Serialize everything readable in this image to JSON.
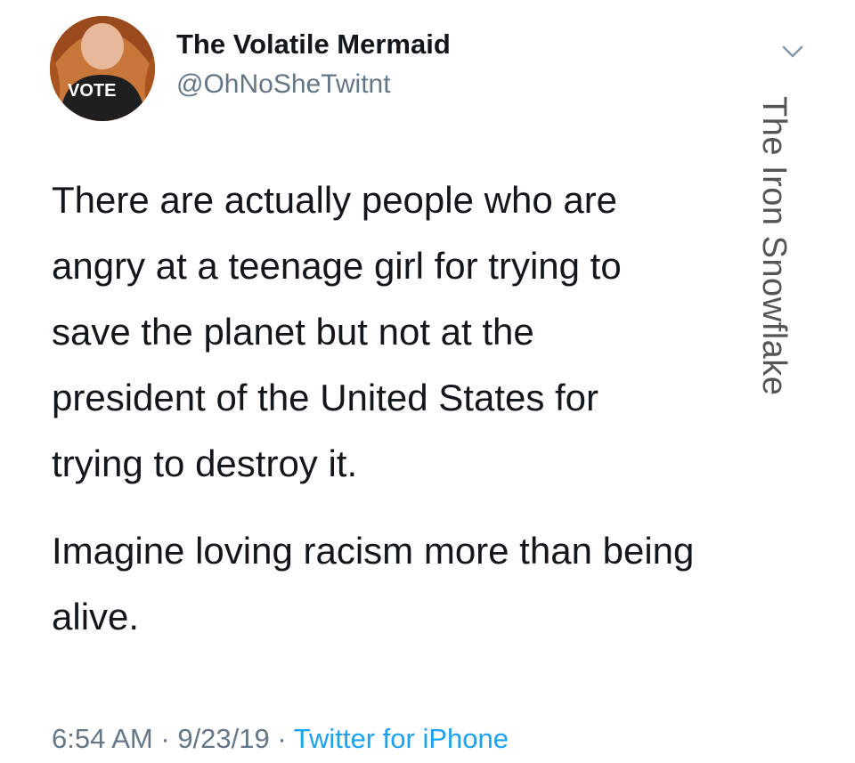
{
  "tweet": {
    "author": {
      "display_name": "The Volatile Mermaid",
      "handle": "@OhNoSheTwitnt",
      "avatar_shirt_text": "VOTE"
    },
    "paragraphs": [
      "There are actually people who are angry at a teenage girl for trying to save the planet but not at the president of the United States for trying to destroy it.",
      "Imagine loving racism more than being alive."
    ],
    "lines": [
      "There are actually people who are",
      "angry at a teenage girl for trying to",
      "save the planet but not at the",
      "president of the United States for",
      "trying to destroy it."
    ],
    "lines2": [
      "Imagine loving racism more than being",
      "alive."
    ],
    "time": "6:54 AM",
    "date": "9/23/19",
    "separator": "·",
    "source": "Twitter for iPhone"
  },
  "watermark": "The Iron Snowflake",
  "icons": {
    "menu": "chevron-down-icon"
  },
  "colors": {
    "text": "#14171a",
    "secondary": "#657786",
    "link": "#1da1f2"
  }
}
